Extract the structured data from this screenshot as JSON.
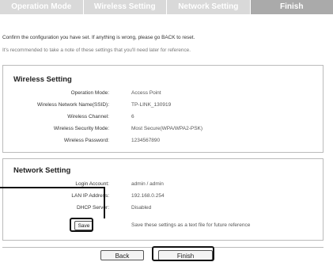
{
  "steps": [
    "Operation Mode",
    "Wireless Setting",
    "Network Setting",
    "Finish"
  ],
  "active_step": 3,
  "intro": {
    "line1": "Confirm the configuration you have set. If anything is wrong, please go BACK to reset.",
    "line2": "It's recommended to take a note of these settings that you'll need later for reference."
  },
  "wireless": {
    "title": "Wireless Setting",
    "rows": [
      {
        "label": "Operation Mode:",
        "value": "Access Point"
      },
      {
        "label": "Wireless Network Name(SSID):",
        "value": "TP-LINK_130919"
      },
      {
        "label": "Wireless Channel:",
        "value": "6"
      },
      {
        "label": "Wireless Security Mode:",
        "value": "Most Secure(WPA/WPA2-PSK)"
      },
      {
        "label": "Wireless Password:",
        "value": "1234567890"
      }
    ]
  },
  "network": {
    "title": "Network Setting",
    "rows": [
      {
        "label": "Login Account:",
        "value": "admin / admin"
      },
      {
        "label": "LAN IP Address:",
        "value": "192.168.0.254"
      },
      {
        "label": "DHCP Server:",
        "value": "Disabled"
      }
    ],
    "save_label": "Save",
    "save_hint": "Save these settings as a text file for future reference"
  },
  "buttons": {
    "back": "Back",
    "finish": "Finish"
  }
}
